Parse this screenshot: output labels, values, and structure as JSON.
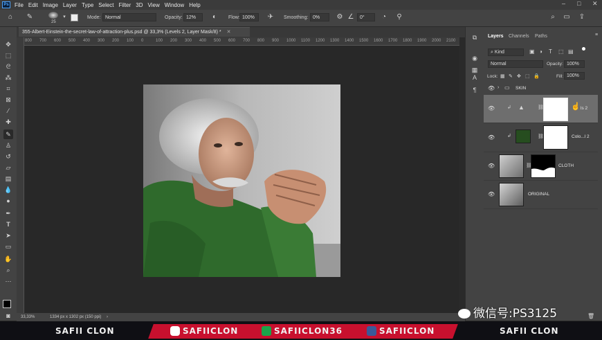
{
  "app": {
    "logo": "Ps"
  },
  "menu": [
    "File",
    "Edit",
    "Image",
    "Layer",
    "Type",
    "Select",
    "Filter",
    "3D",
    "View",
    "Window",
    "Help"
  ],
  "window_controls": [
    "–",
    "□",
    "✕"
  ],
  "options": {
    "brush_size": "25",
    "mode_label": "Mode:",
    "mode_value": "Normal",
    "opacity_label": "Opacity:",
    "opacity_value": "12%",
    "flow_label": "Flow:",
    "flow_value": "100%",
    "smoothing_label": "Smoothing:",
    "smoothing_value": "0%",
    "angle_value": "0°"
  },
  "document": {
    "tab_title": "355-Albert-Einstein-the-secret-law-of-attraction-plus.psd @ 33,3% (Levels 2, Layer Mask/8) *",
    "zoom": "33,33%",
    "info": "1334 px x 1302 px (150 ppi)"
  },
  "ruler_ticks": [
    "800",
    "700",
    "600",
    "500",
    "400",
    "300",
    "200",
    "100",
    "0",
    "100",
    "200",
    "300",
    "400",
    "500",
    "600",
    "700",
    "800",
    "900",
    "1000",
    "1100",
    "1200",
    "1300",
    "1400",
    "1500",
    "1600",
    "1700",
    "1800",
    "1900",
    "2000",
    "2100"
  ],
  "layers_panel": {
    "tabs": [
      "Layers",
      "Channels",
      "Paths"
    ],
    "filter_kind": "Kind",
    "blend_mode": "Normal",
    "opacity_label": "Opacity:",
    "opacity_value": "100%",
    "lock_label": "Lock:",
    "fill_label": "Fill:",
    "fill_value": "100%",
    "layers": [
      {
        "name": "SKIN",
        "type": "group"
      },
      {
        "name": "ls 2",
        "type": "levels-adjustment",
        "selected": true
      },
      {
        "name": "Colo...l 2",
        "type": "color-fill"
      },
      {
        "name": "CLOTH",
        "type": "image-with-mask"
      },
      {
        "name": "ORIGINAL",
        "type": "image"
      }
    ]
  },
  "banner": {
    "left_name": "SAFII CLON",
    "instagram": "SAFIICLON",
    "tiktok": "SAFIICLON36",
    "facebook": "SAFIICLON",
    "right_name": "SAFII CLON"
  },
  "watermark": "微信号:PS3125",
  "colors": {
    "accent": "#c8102e",
    "selected_layer": "#6e6e6e",
    "sweater": "#2f6a2c"
  }
}
